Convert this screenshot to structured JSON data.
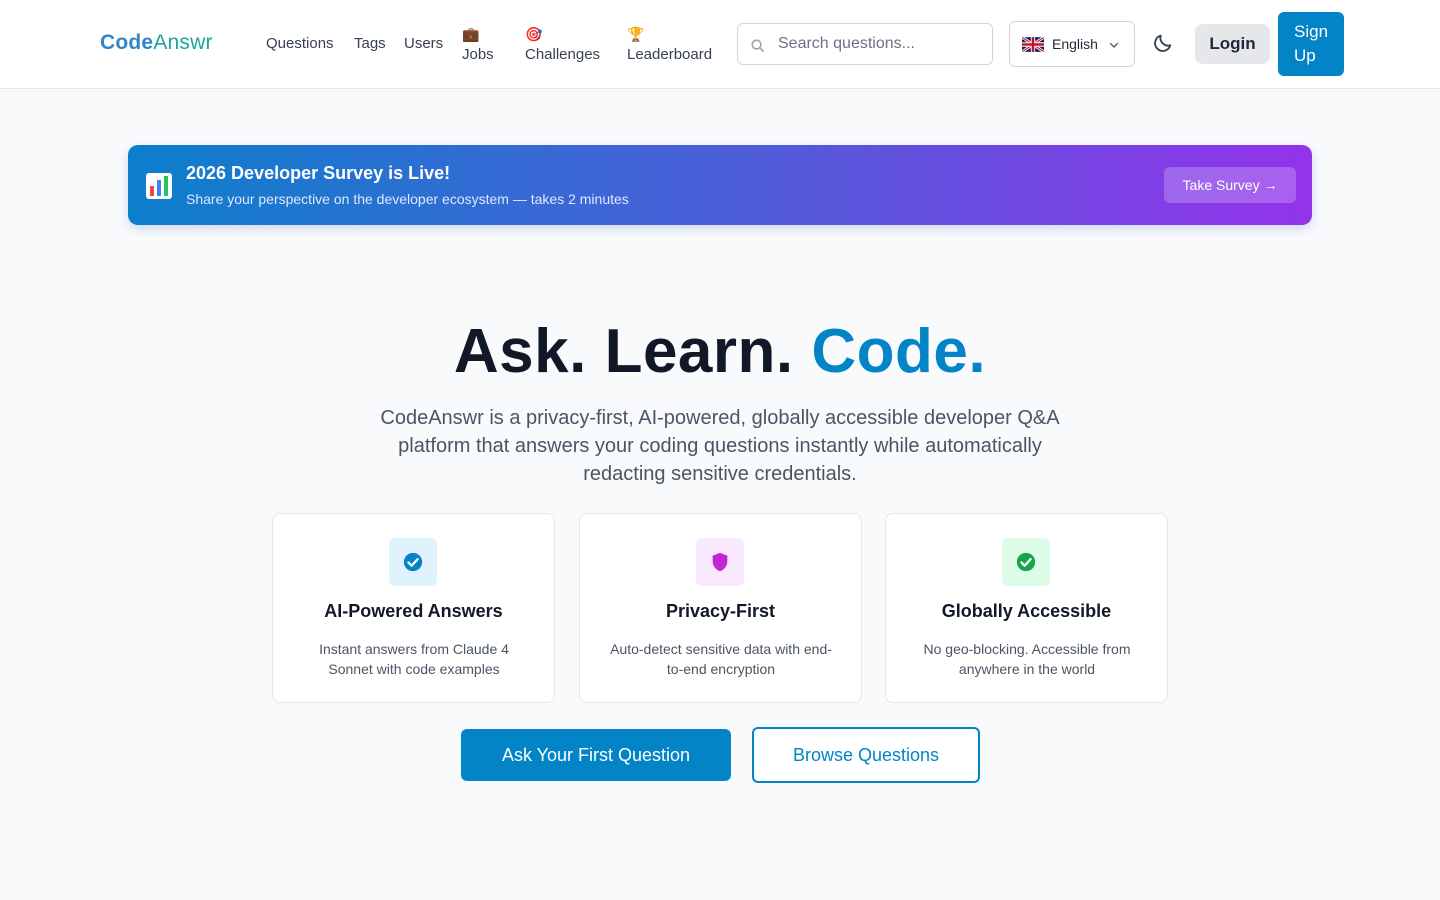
{
  "header": {
    "logo_part1": "Code",
    "logo_part2": "Answr",
    "nav": {
      "questions": "Questions",
      "tags": "Tags",
      "users": "Users",
      "jobs": "Jobs",
      "challenges": "Challenges",
      "leaderboard": "Leaderboard"
    },
    "nav_emoji": {
      "jobs": "💼",
      "challenges": "🎯",
      "leaderboard": "🏆"
    },
    "search_placeholder": "Search questions...",
    "language": "English",
    "login": "Login",
    "signup": "Sign Up"
  },
  "banner": {
    "icon": "📊",
    "title": "2026 Developer Survey is Live!",
    "subtitle": "Share your perspective on the developer ecosystem — takes 2 minutes",
    "button": "Take Survey →"
  },
  "hero": {
    "title_part1": "Ask. Learn.",
    "title_accent": "Code.",
    "subtitle": "CodeAnswr is a privacy-first, AI-powered, globally accessible developer Q&A platform that answers your coding questions instantly while automatically redacting sensitive credentials."
  },
  "features": [
    {
      "title": "AI-Powered Answers",
      "desc": "Instant answers from Claude 4 Sonnet with code examples",
      "icon": "check-badge-icon"
    },
    {
      "title": "Privacy-First",
      "desc": "Auto-detect sensitive data with end-to-end encryption",
      "icon": "shield-icon"
    },
    {
      "title": "Globally Accessible",
      "desc": "No geo-blocking. Accessible from anywhere in the world",
      "icon": "check-circle-icon"
    }
  ],
  "cta": {
    "primary": "Ask Your First Question",
    "secondary": "Browse Questions"
  },
  "colors": {
    "primary": "#0284c7",
    "privacy": "#c026d3",
    "global": "#16a34a"
  }
}
